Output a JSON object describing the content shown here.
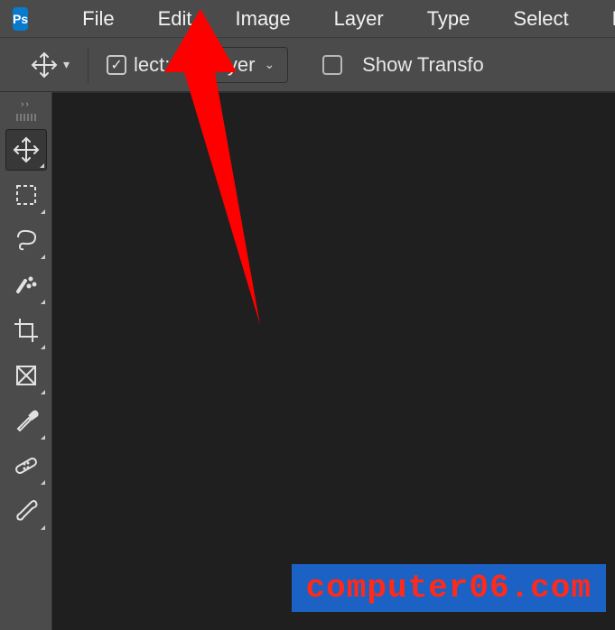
{
  "app": {
    "logo_text": "Ps"
  },
  "menubar": {
    "items": [
      "File",
      "Edit",
      "Image",
      "Layer",
      "Type",
      "Select",
      "Fi"
    ]
  },
  "optionsbar": {
    "auto_select_checked": true,
    "auto_select_label": "lect:",
    "layer_dropdown": "Layer",
    "show_transform_checked": false,
    "show_transform_label": "Show Transfo"
  },
  "tools": [
    {
      "id": "move",
      "active": true
    },
    {
      "id": "marquee",
      "active": false
    },
    {
      "id": "lasso",
      "active": false
    },
    {
      "id": "quick-select",
      "active": false
    },
    {
      "id": "crop",
      "active": false
    },
    {
      "id": "frame",
      "active": false
    },
    {
      "id": "eyedropper",
      "active": false
    },
    {
      "id": "healing",
      "active": false
    },
    {
      "id": "brush",
      "active": false
    }
  ],
  "watermark": "computer06.com",
  "annotation": {
    "target": "Edit menu",
    "color": "#ff0000"
  }
}
